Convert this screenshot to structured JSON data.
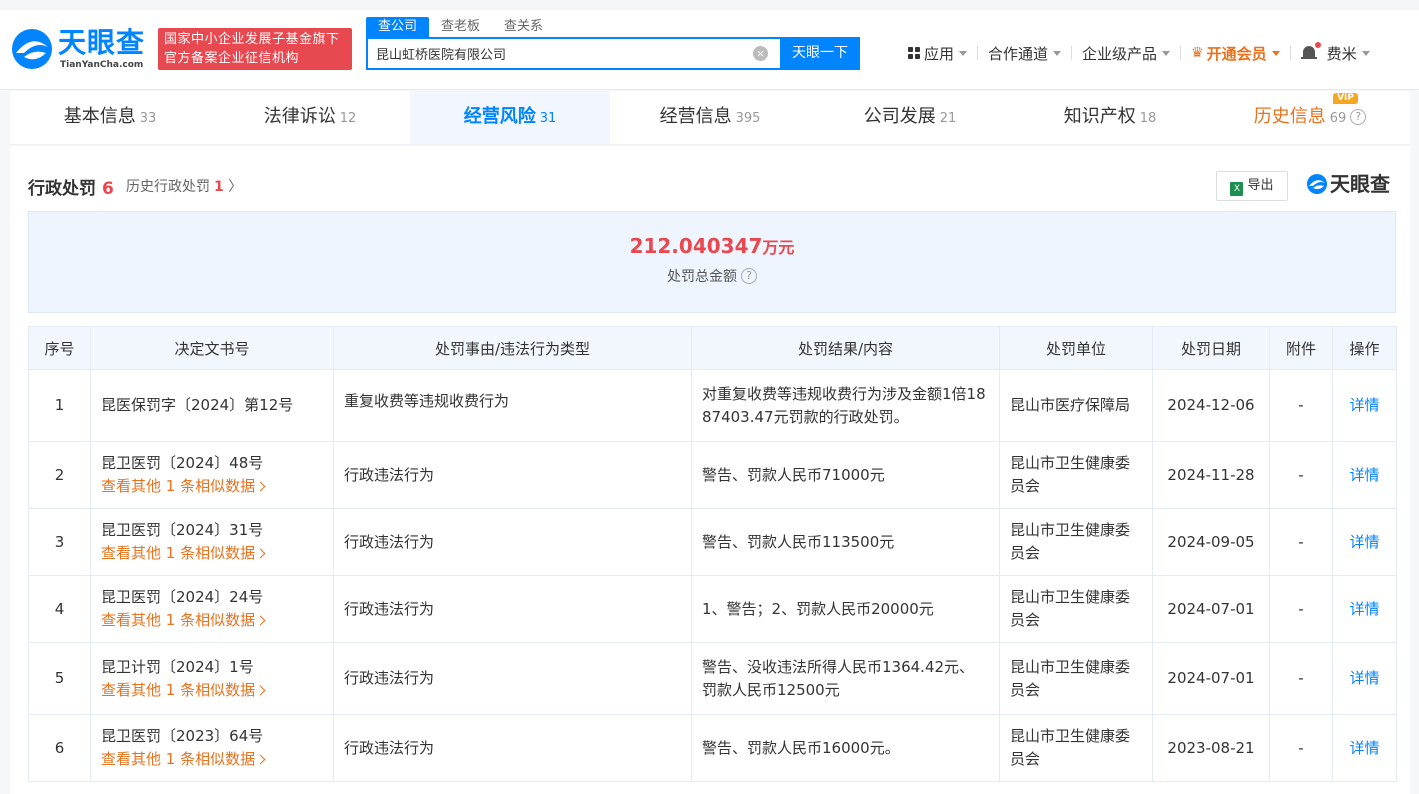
{
  "brand": {
    "name_cn": "天眼查",
    "name_en": "TianYanCha.com",
    "badge_line1": "国家中小企业发展子基金旗下",
    "badge_line2": "官方备案企业征信机构"
  },
  "search": {
    "tabs": [
      "查公司",
      "查老板",
      "查关系"
    ],
    "active_tab": "查公司",
    "value": "昆山虹桥医院有限公司",
    "button": "天眼一下"
  },
  "topnav": {
    "apps": "应用",
    "channel": "合作通道",
    "enterprise": "企业级产品",
    "vip": "开通会员",
    "user": "费米"
  },
  "tabs": [
    {
      "label": "基本信息",
      "count": "33"
    },
    {
      "label": "法律诉讼",
      "count": "12"
    },
    {
      "label": "经营风险",
      "count": "31"
    },
    {
      "label": "经营信息",
      "count": "395"
    },
    {
      "label": "公司发展",
      "count": "21"
    },
    {
      "label": "知识产权",
      "count": "18"
    },
    {
      "label": "历史信息",
      "count": "69",
      "tag": "VIP"
    }
  ],
  "section": {
    "title": "行政处罚",
    "count": "6",
    "history_label": "历史行政处罚",
    "history_count": "1",
    "export": "导出",
    "brand": "天眼查"
  },
  "summary": {
    "amount": "212.040347",
    "unit": "万元",
    "label": "处罚总金额"
  },
  "table": {
    "headers": [
      "序号",
      "决定文书号",
      "处罚事由/违法行为类型",
      "处罚结果/内容",
      "处罚单位",
      "处罚日期",
      "附件",
      "操作"
    ],
    "more_text": "查看其他 1 条相似数据",
    "rows": [
      {
        "no": "1",
        "doc": "昆医保罚字〔2024〕第12号",
        "reason": "重复收费等违规收费行为",
        "result": "对重复收费等违规收费行为涉及金额1倍1887403.47元罚款的行政处罚。",
        "unit": "昆山市医疗保障局",
        "date": "2024-12-06",
        "attach": "-",
        "action": "详情"
      },
      {
        "no": "2",
        "doc": "昆卫医罚〔2024〕48号",
        "reason": "行政违法行为",
        "result": "警告、罚款人民币71000元",
        "unit": "昆山市卫生健康委员会",
        "date": "2024-11-28",
        "attach": "-",
        "action": "详情"
      },
      {
        "no": "3",
        "doc": "昆卫医罚〔2024〕31号",
        "reason": "行政违法行为",
        "result": "警告、罚款人民币113500元",
        "unit": "昆山市卫生健康委员会",
        "date": "2024-09-05",
        "attach": "-",
        "action": "详情"
      },
      {
        "no": "4",
        "doc": "昆卫医罚〔2024〕24号",
        "reason": "行政违法行为",
        "result": "1、警告；2、罚款人民币20000元",
        "unit": "昆山市卫生健康委员会",
        "date": "2024-07-01",
        "attach": "-",
        "action": "详情"
      },
      {
        "no": "5",
        "doc": "昆卫计罚〔2024〕1号",
        "reason": "行政违法行为",
        "result": "警告、没收违法所得人民币1364.42元、罚款人民币12500元",
        "unit": "昆山市卫生健康委员会",
        "date": "2024-07-01",
        "attach": "-",
        "action": "详情"
      },
      {
        "no": "6",
        "doc": "昆卫医罚〔2023〕64号",
        "reason": "行政违法行为",
        "result": "警告、罚款人民币16000元。",
        "unit": "昆山市卫生健康委员会",
        "date": "2023-08-21",
        "attach": "-",
        "action": "详情"
      }
    ]
  },
  "colors": {
    "primary": "#0084ff",
    "accent_red": "#e8484f",
    "accent_orange": "#e8721d"
  }
}
